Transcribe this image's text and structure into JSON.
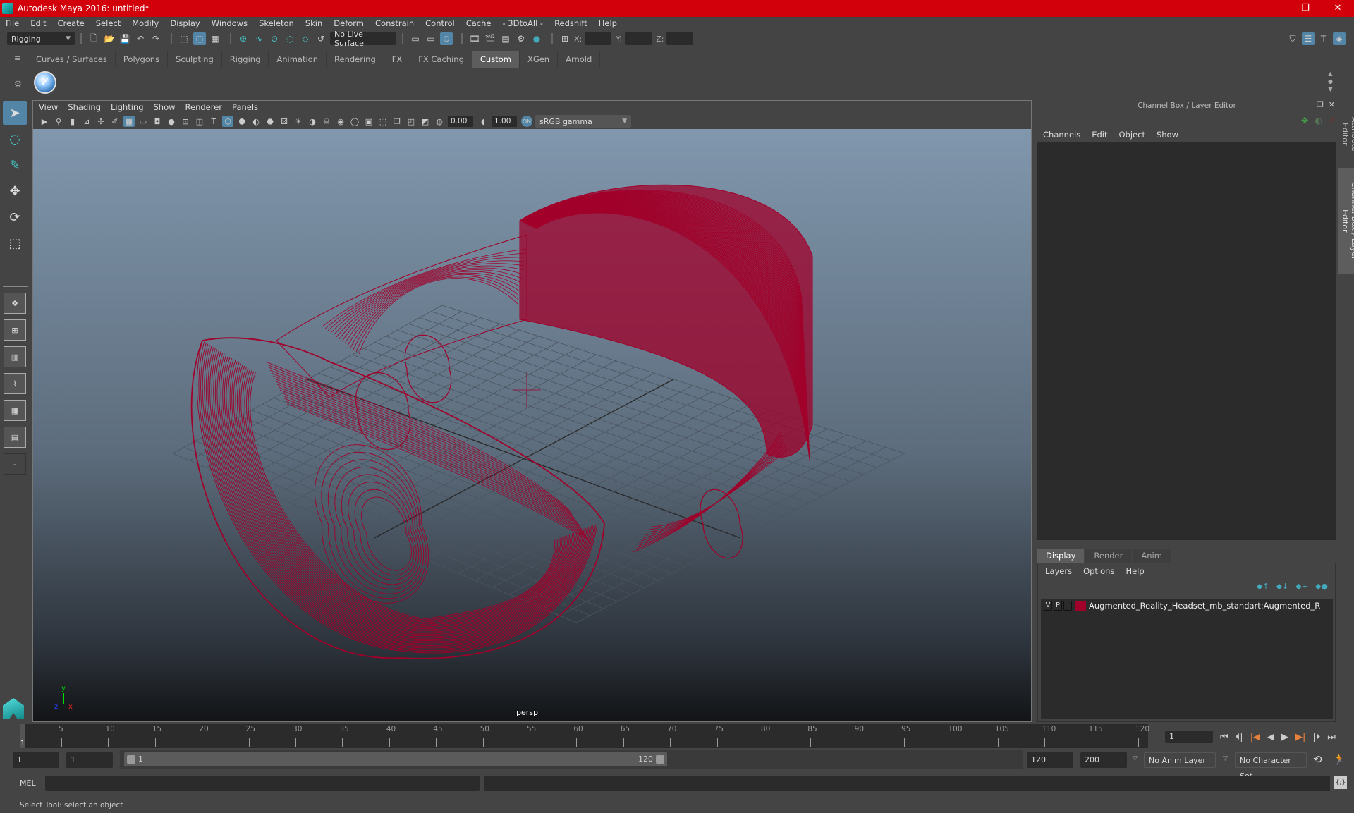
{
  "window": {
    "title": "Autodesk Maya 2016: untitled*",
    "controls": [
      "minimize",
      "restore",
      "close"
    ]
  },
  "menubar": [
    "File",
    "Edit",
    "Create",
    "Select",
    "Modify",
    "Display",
    "Windows",
    "Skeleton",
    "Skin",
    "Deform",
    "Constrain",
    "Control",
    "Cache",
    "- 3DtoAll -",
    "Redshift",
    "Help"
  ],
  "statusline": {
    "menuset": "Rigging",
    "live_surface": "No Live Surface",
    "coords": {
      "x_label": "X:",
      "y_label": "Y:",
      "z_label": "Z:",
      "x": "",
      "y": "",
      "z": ""
    }
  },
  "shelf": {
    "tabs": [
      "Curves / Surfaces",
      "Polygons",
      "Sculpting",
      "Rigging",
      "Animation",
      "Rendering",
      "FX",
      "FX Caching",
      "Custom",
      "XGen",
      "Arnold"
    ],
    "active_tab": "Custom"
  },
  "viewport": {
    "menu": [
      "View",
      "Shading",
      "Lighting",
      "Show",
      "Renderer",
      "Panels"
    ],
    "exposure": "0.00",
    "gamma": "1.00",
    "color_space": "sRGB gamma",
    "camera_label": "persp",
    "axis": {
      "x": "x",
      "y": "y",
      "z": "z"
    },
    "wireframe_color": "#a0002a"
  },
  "channel_box": {
    "title": "Channel Box / Layer Editor",
    "menu": [
      "Channels",
      "Edit",
      "Object",
      "Show"
    ]
  },
  "layer_editor": {
    "tabs": [
      "Display",
      "Render",
      "Anim"
    ],
    "active_tab": "Display",
    "menu": [
      "Layers",
      "Options",
      "Help"
    ],
    "layers": [
      {
        "v": "V",
        "p": "P",
        "color": "#a0002a",
        "name": "Augmented_Reality_Headset_mb_standart:Augmented_R"
      }
    ]
  },
  "side_tabs": [
    "Attribute Editor",
    "Channel Box / Layer Editor"
  ],
  "timeline": {
    "start": 1,
    "end": 120,
    "current": 1,
    "labels": [
      "5",
      "10",
      "15",
      "20",
      "25",
      "30",
      "35",
      "40",
      "45",
      "50",
      "55",
      "60",
      "65",
      "70",
      "75",
      "80",
      "85",
      "90",
      "95",
      "100",
      "105",
      "110",
      "115",
      "120"
    ],
    "current_frame_field": "1"
  },
  "range": {
    "start_field": "1",
    "playback_start": "1",
    "slider_start": "1",
    "slider_end": "120",
    "playback_end": "120",
    "end_field": "200",
    "anim_layer": "No Anim Layer",
    "character_set": "No Character Set"
  },
  "command_line": {
    "label": "MEL",
    "value": ""
  },
  "help_line": "Select Tool: select an object"
}
